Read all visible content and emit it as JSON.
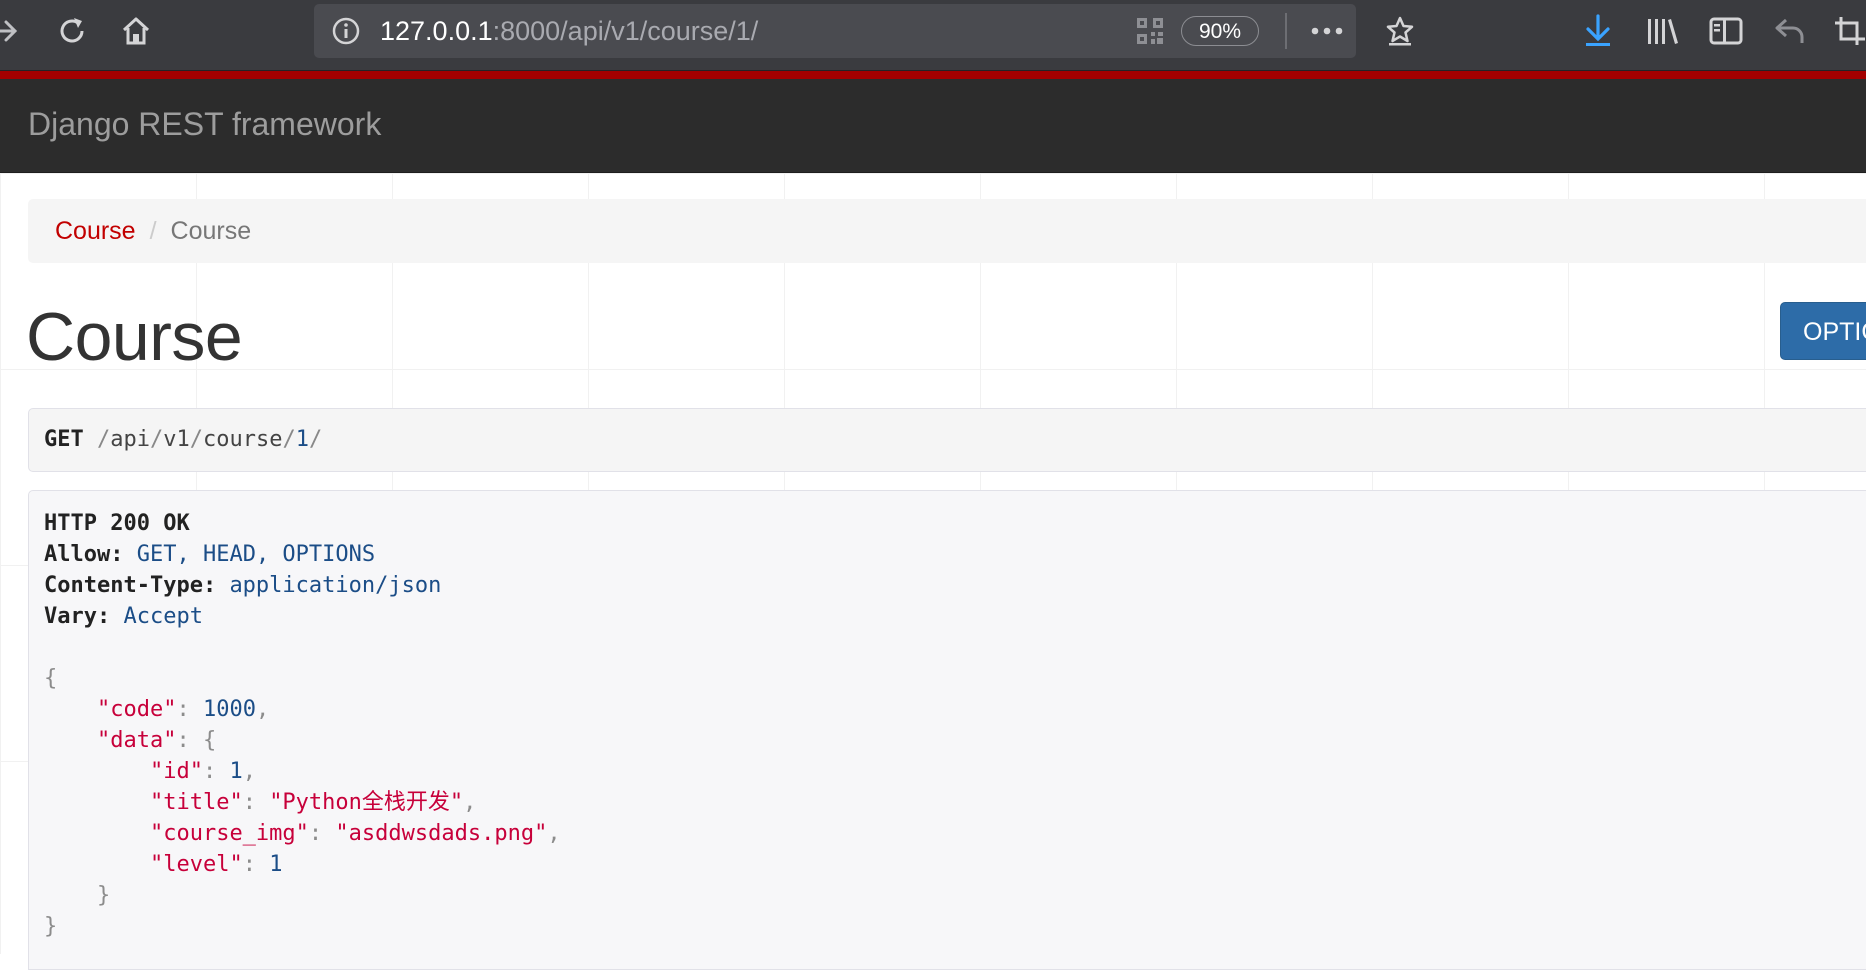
{
  "browser": {
    "url_host": "127.0.0.1",
    "url_rest": ":8000/api/v1/course/1/",
    "zoom": "90%",
    "icons": [
      "forward-icon",
      "reload-icon",
      "home-icon",
      "info-icon",
      "qr-code-icon",
      "more-icon",
      "bookmark-star-icon",
      "download-icon",
      "library-icon",
      "sidebar-icon",
      "undo-icon",
      "screenshot-icon"
    ]
  },
  "navbar": {
    "brand": "Django REST framework"
  },
  "breadcrumb": {
    "items": [
      "Course",
      "Course"
    ],
    "separator": "/"
  },
  "page": {
    "title": "Course",
    "options_button": "OPTIONS"
  },
  "request": {
    "method": "GET",
    "path_parts": [
      "/",
      "api",
      "/",
      "v1",
      "/",
      "course",
      "/",
      "1",
      "/"
    ]
  },
  "response": {
    "status": "HTTP 200 OK",
    "headers": [
      {
        "key": "Allow:",
        "value": "GET, HEAD, OPTIONS"
      },
      {
        "key": "Content-Type:",
        "value": "application/json"
      },
      {
        "key": "Vary:",
        "value": "Accept"
      }
    ],
    "body": {
      "open_brace": "{",
      "code_key": "\"code\"",
      "code_value": "1000",
      "data_key": "\"data\"",
      "data_open": "{",
      "id_key": "\"id\"",
      "id_value": "1",
      "title_key": "\"title\"",
      "title_value": "\"Python全栈开发\"",
      "course_img_key": "\"course_img\"",
      "course_img_value": "\"asddwsdads.png\"",
      "level_key": "\"level\"",
      "level_value": "1",
      "data_close": "}",
      "close_brace": "}"
    }
  },
  "colors": {
    "accent_red": "#a30000",
    "navbar_bg": "#2c2c2c",
    "link_red": "#c20000",
    "button_blue": "#2d6ca8",
    "json_key": "#c7003a",
    "json_number": "#1b4d87"
  }
}
